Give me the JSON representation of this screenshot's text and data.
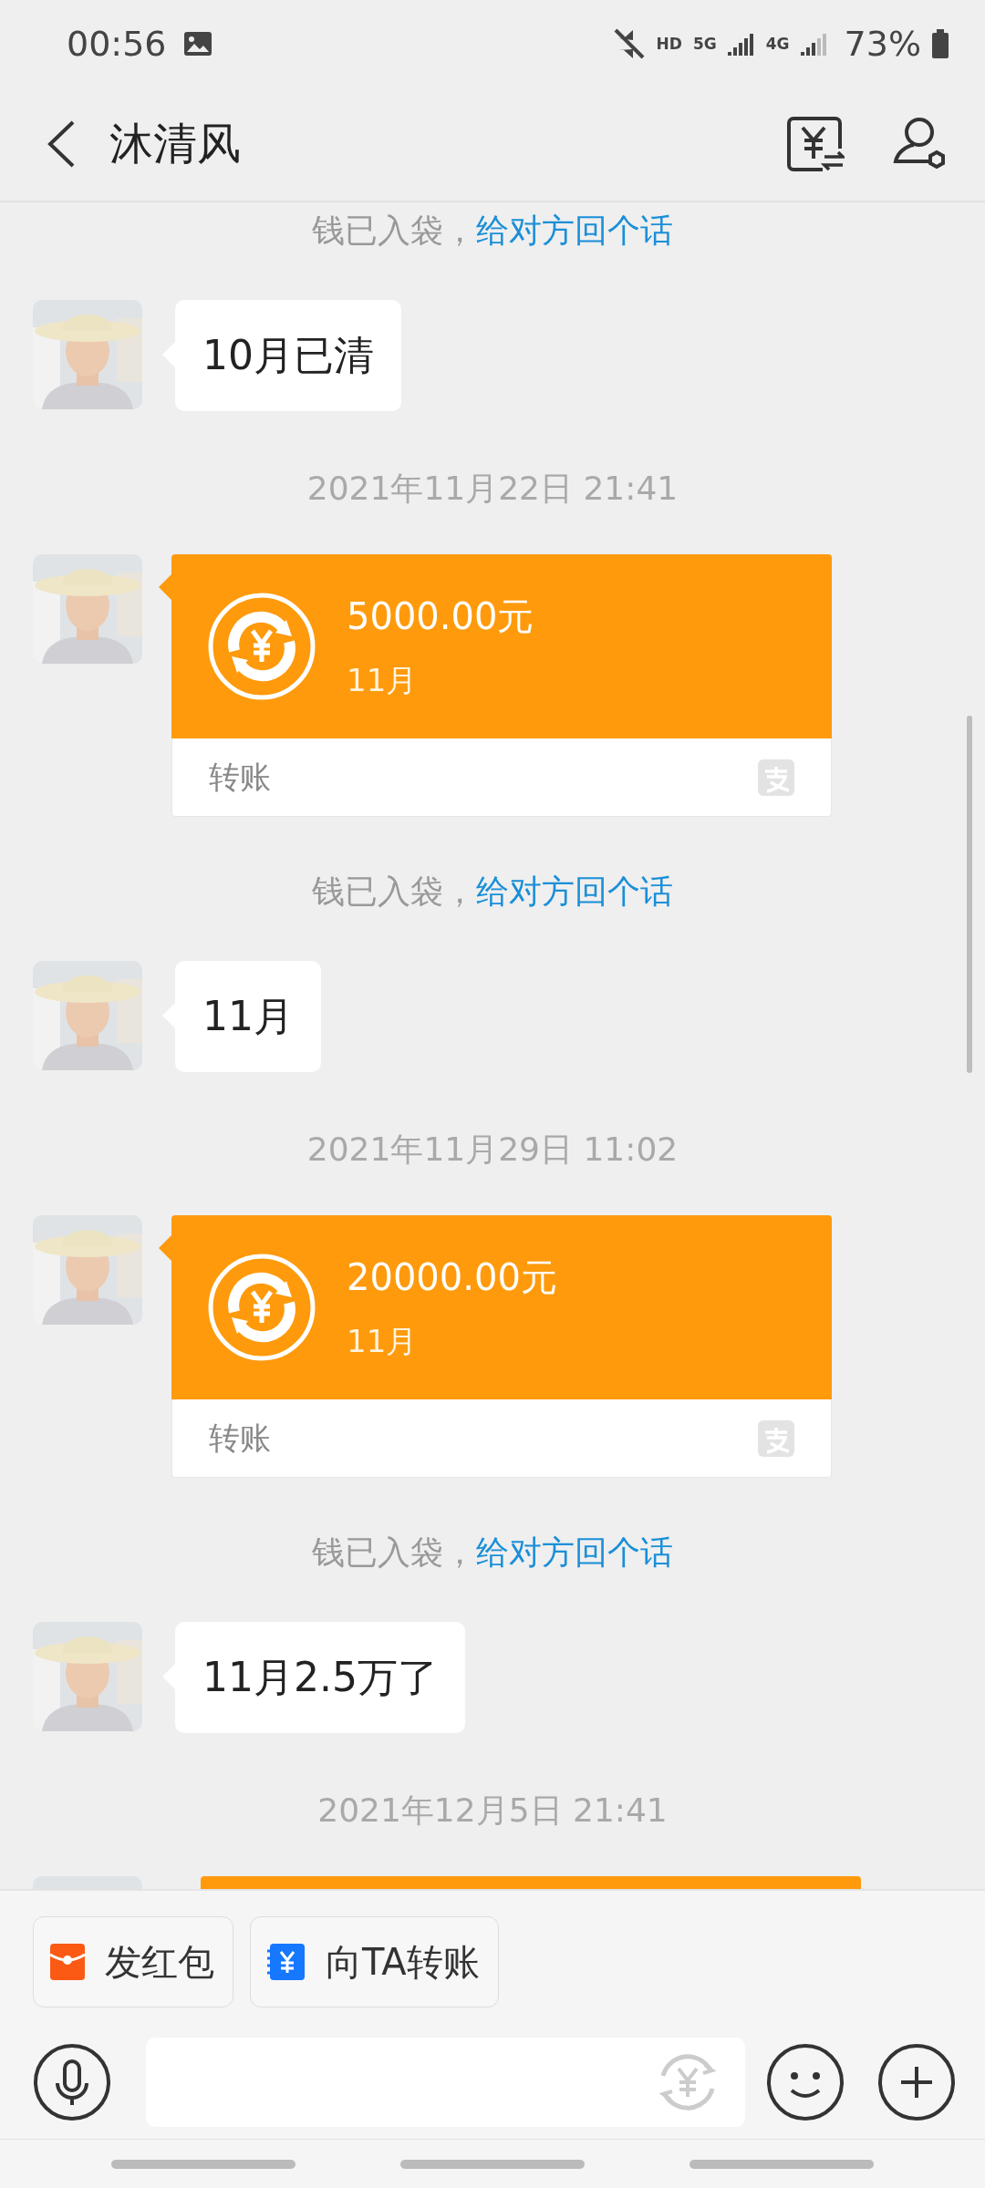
{
  "status_bar": {
    "time": "00:56",
    "network_labels": [
      "HD",
      "5G",
      "4G"
    ],
    "battery": "73%"
  },
  "header": {
    "title": "沐清风"
  },
  "messages": [
    {
      "kind": "notice",
      "text": "钱已入袋，",
      "link": "给对方回个话"
    },
    {
      "kind": "text",
      "text": "10月已清"
    },
    {
      "kind": "time",
      "text": "2021年11月22日 21:41"
    },
    {
      "kind": "transfer",
      "amount": "5000.00元",
      "note": "11月",
      "footer": "转账"
    },
    {
      "kind": "notice",
      "text": "钱已入袋，",
      "link": "给对方回个话"
    },
    {
      "kind": "text",
      "text": "11月"
    },
    {
      "kind": "time",
      "text": "2021年11月29日 11:02"
    },
    {
      "kind": "transfer",
      "amount": "20000.00元",
      "note": "11月",
      "footer": "转账"
    },
    {
      "kind": "notice",
      "text": "钱已入袋，",
      "link": "给对方回个话"
    },
    {
      "kind": "text",
      "text": "11月2.5万了"
    },
    {
      "kind": "time",
      "text": "2021年12月5日 21:41"
    },
    {
      "kind": "transfer_edge"
    }
  ],
  "shortcuts": [
    {
      "kind": "red_packet",
      "label": "发红包"
    },
    {
      "kind": "transfer",
      "label": "向TA转账"
    }
  ]
}
